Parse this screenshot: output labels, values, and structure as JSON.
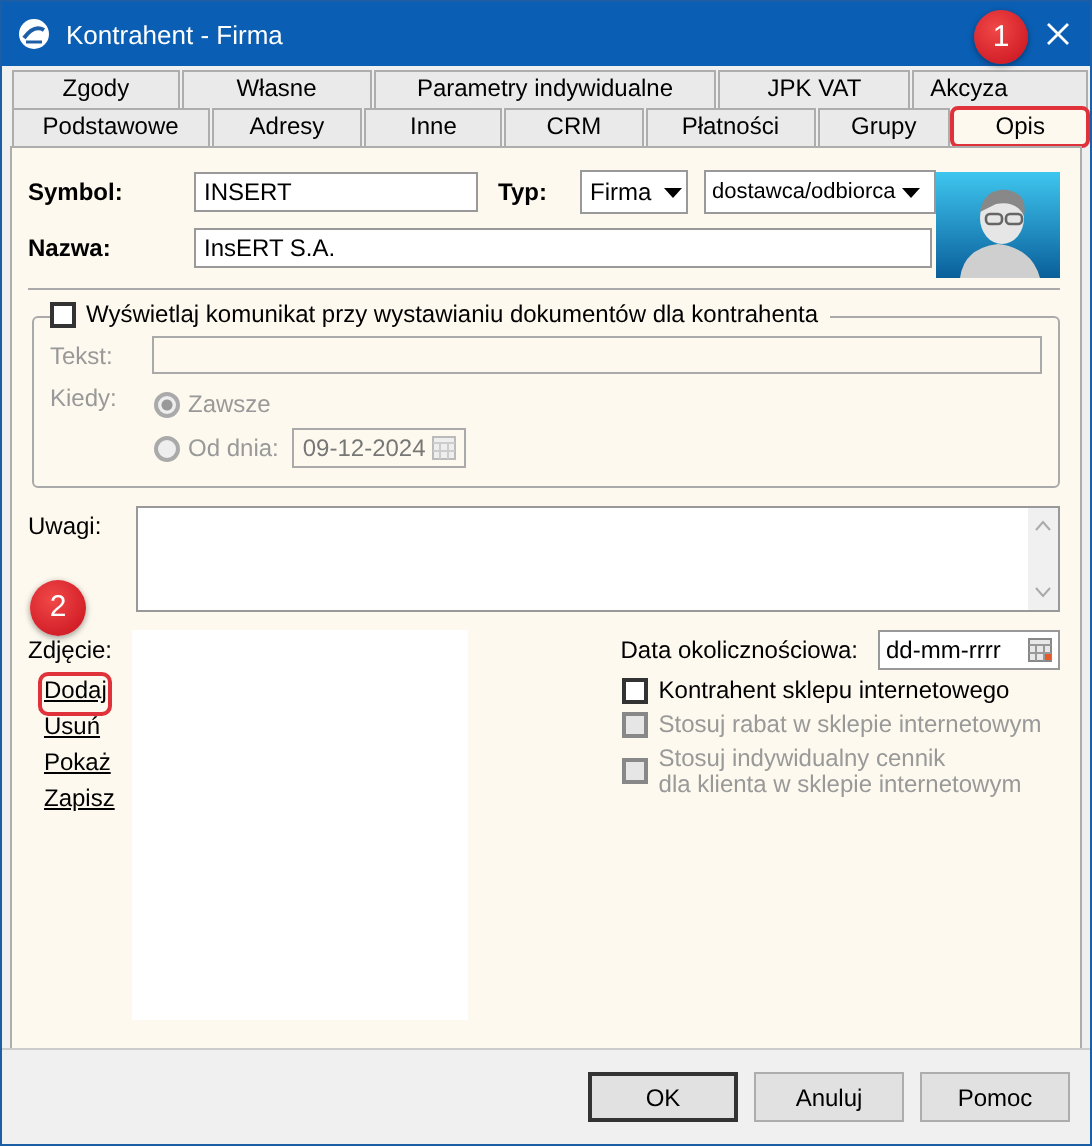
{
  "window": {
    "title": "Kontrahent - Firma"
  },
  "tab_rows": [
    [
      {
        "label": "Zgody",
        "selected": false,
        "highlighted": false
      },
      {
        "label": "Własne",
        "selected": false,
        "highlighted": false
      },
      {
        "label": "Parametry indywidualne",
        "selected": false,
        "highlighted": false
      },
      {
        "label": "JPK VAT",
        "selected": false,
        "highlighted": false
      },
      {
        "label": "Akcyza",
        "selected": false,
        "highlighted": false
      }
    ],
    [
      {
        "label": "Podstawowe",
        "selected": false,
        "highlighted": false
      },
      {
        "label": "Adresy",
        "selected": false,
        "highlighted": false
      },
      {
        "label": "Inne",
        "selected": false,
        "highlighted": false
      },
      {
        "label": "CRM",
        "selected": false,
        "highlighted": false
      },
      {
        "label": "Płatności",
        "selected": false,
        "highlighted": false
      },
      {
        "label": "Grupy",
        "selected": false,
        "highlighted": false
      },
      {
        "label": "Opis",
        "selected": true,
        "highlighted": true
      }
    ]
  ],
  "symbol": {
    "label": "Symbol:",
    "value": "INSERT"
  },
  "typ": {
    "label": "Typ:",
    "value": "Firma",
    "role": "dostawca/odbiorca"
  },
  "nazwa": {
    "label": "Nazwa:",
    "value": "InsERT S.A."
  },
  "message_group": {
    "label": "Wyświetlaj komunikat przy wystawianiu dokumentów dla kontrahenta",
    "checked": false,
    "text_label": "Tekst:",
    "when_label": "Kiedy:",
    "options": [
      {
        "label": "Zawsze",
        "selected": true,
        "disabled": true
      },
      {
        "label": "Od dnia:",
        "selected": false,
        "disabled": true
      }
    ],
    "date": "09-12-2024"
  },
  "uwagi": {
    "label": "Uwagi:"
  },
  "photo": {
    "label": "Zdjęcie:",
    "links": [
      {
        "label": "Dodaj",
        "highlighted": true
      },
      {
        "label": "Usuń",
        "highlighted": false
      },
      {
        "label": "Pokaż",
        "highlighted": false
      },
      {
        "label": "Zapisz",
        "highlighted": false
      }
    ]
  },
  "occasion_date": {
    "label": "Data okolicznościowa:",
    "placeholder": "dd-mm-rrrr"
  },
  "shop_options": [
    {
      "label": "Kontrahent sklepu internetowego",
      "checked": false,
      "disabled": false
    },
    {
      "label": "Stosuj rabat w sklepie internetowym",
      "checked": false,
      "disabled": true
    },
    {
      "label": "Stosuj indywidualny cennik\ndla klienta w sklepie internetowym",
      "checked": false,
      "disabled": true
    }
  ],
  "buttons": [
    {
      "label": "OK",
      "default": true
    },
    {
      "label": "Anuluj",
      "default": false
    },
    {
      "label": "Pomoc",
      "default": false
    }
  ],
  "annotations": [
    "1",
    "2"
  ]
}
